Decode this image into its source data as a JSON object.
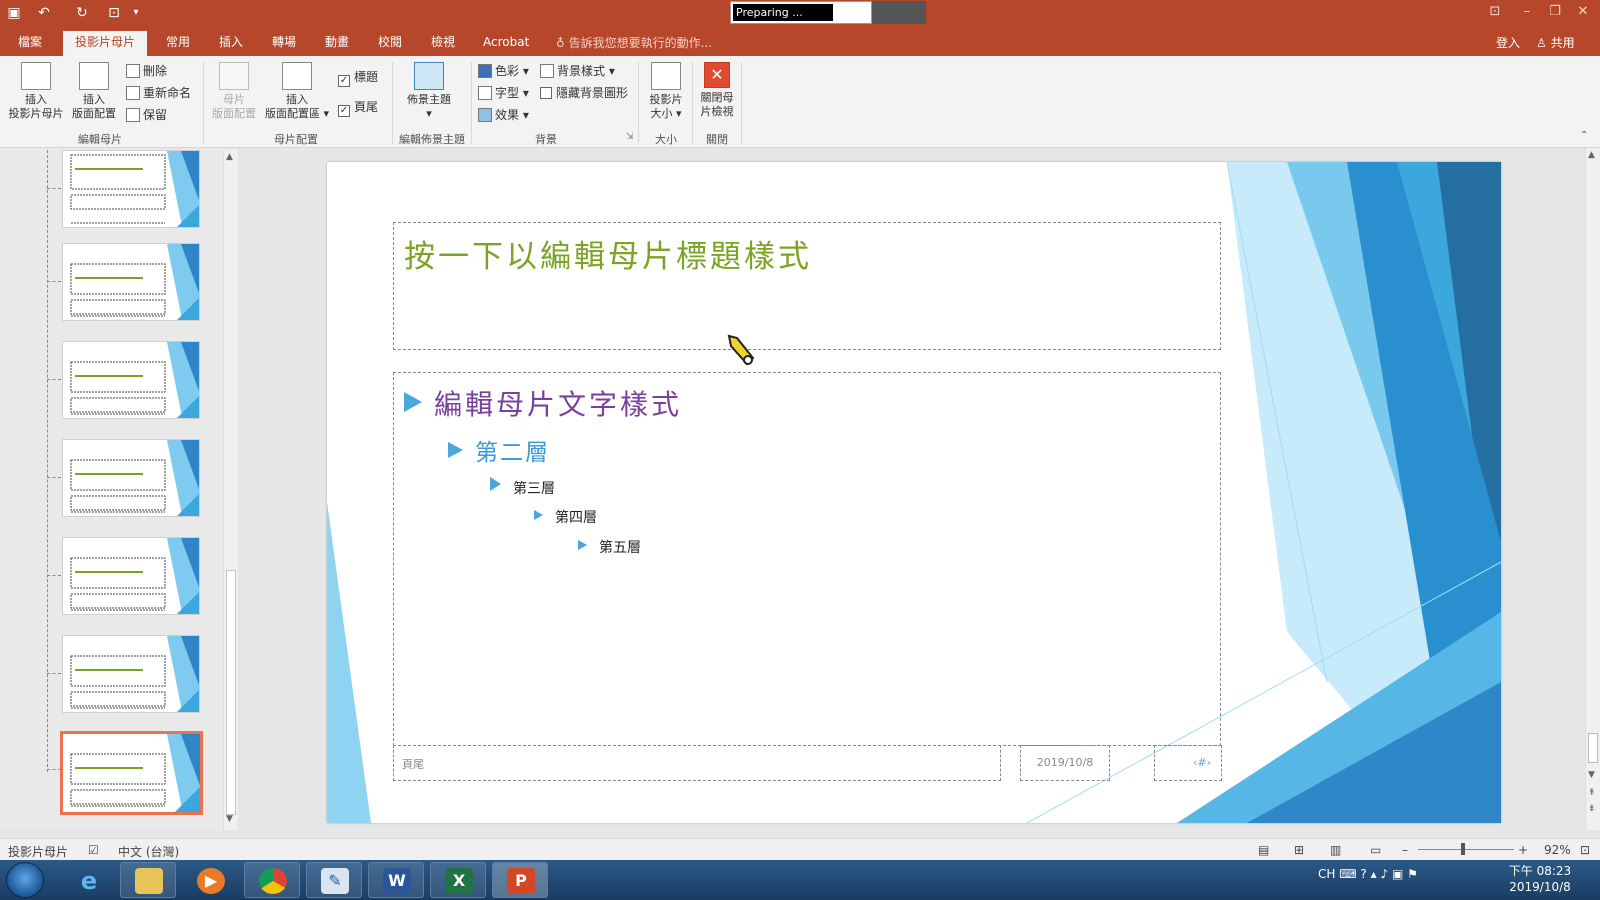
{
  "window": {
    "preparing": "Preparing ..."
  },
  "tabs": {
    "file": "檔案",
    "slide_master": "投影片母片",
    "home": "常用",
    "insert": "插入",
    "transitions": "轉場",
    "animations": "動畫",
    "review": "校閱",
    "view": "檢視",
    "acrobat": "Acrobat"
  },
  "tell_me": "告訴我您想要執行的動作...",
  "sign_in": "登入",
  "share": "共用",
  "ribbon": {
    "insert_slide_master": [
      "插入",
      "投影片母片"
    ],
    "insert_layout": [
      "插入",
      "版面配置"
    ],
    "delete": "刪除",
    "rename": "重新命名",
    "preserve": "保留",
    "group_edit_master": "編輯母片",
    "master_layout": [
      "母片",
      "版面配置"
    ],
    "insert_placeholder": [
      "插入",
      "版面配置區"
    ],
    "title_check": "標題",
    "footer_check": "頁尾",
    "group_master_layout": "母片配置",
    "themes": "佈景主題",
    "group_edit_theme": "編輯佈景主題",
    "colors": "色彩",
    "fonts": "字型",
    "effects": "效果",
    "bg_styles": "背景樣式",
    "hide_bg": "隱藏背景圖形",
    "group_background": "背景",
    "slide_size": [
      "投影片",
      "大小"
    ],
    "group_size": "大小",
    "close_master": [
      "關閉母",
      "片檢視"
    ],
    "group_close": "關閉"
  },
  "slide": {
    "title": "按一下以編輯母片標題樣式",
    "level1": "編輯母片文字樣式",
    "level2": "第二層",
    "level3": "第三層",
    "level4": "第四層",
    "level5": "第五層",
    "footer": "頁尾",
    "date": "2019/10/8",
    "number": "‹#›"
  },
  "status": {
    "view": "投影片母片",
    "language": "中文 (台灣)",
    "zoom": "92%",
    "zoom_level_pct": 92
  },
  "taskbar": {
    "time": "下午 08:23",
    "date": "2019/10/8",
    "ime": "CH"
  },
  "colors": {
    "accent": "#b7472a",
    "title_green": "#7aa424",
    "level1_purple": "#7b3f9e",
    "level2_blue": "#3c9ad6"
  }
}
